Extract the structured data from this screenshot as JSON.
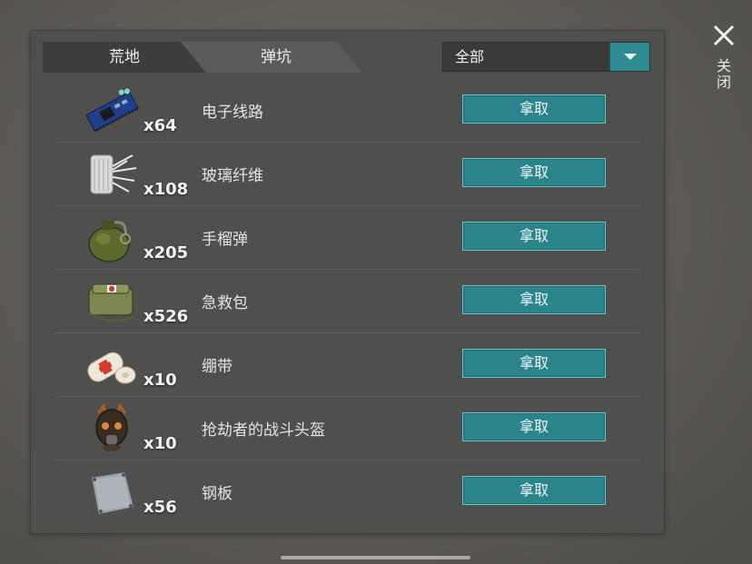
{
  "tabs": [
    {
      "label": "荒地"
    },
    {
      "label": "弹坑"
    }
  ],
  "filter": {
    "value": "全部"
  },
  "close": {
    "label": "关闭"
  },
  "items": [
    {
      "name": "电子线路",
      "count": "x64",
      "button": "拿取",
      "icon": "circuit-board-icon"
    },
    {
      "name": "玻璃纤维",
      "count": "x108",
      "button": "拿取",
      "icon": "fiberglass-icon"
    },
    {
      "name": "手榴弹",
      "count": "x205",
      "button": "拿取",
      "icon": "grenade-icon"
    },
    {
      "name": "急救包",
      "count": "x526",
      "button": "拿取",
      "icon": "first-aid-kit-icon"
    },
    {
      "name": "绷带",
      "count": "x10",
      "button": "拿取",
      "icon": "bandage-icon"
    },
    {
      "name": "抢劫者的战斗头盔",
      "count": "x10",
      "button": "拿取",
      "icon": "raider-helmet-icon"
    },
    {
      "name": "钢板",
      "count": "x56",
      "button": "拿取",
      "icon": "steel-plate-icon"
    }
  ]
}
